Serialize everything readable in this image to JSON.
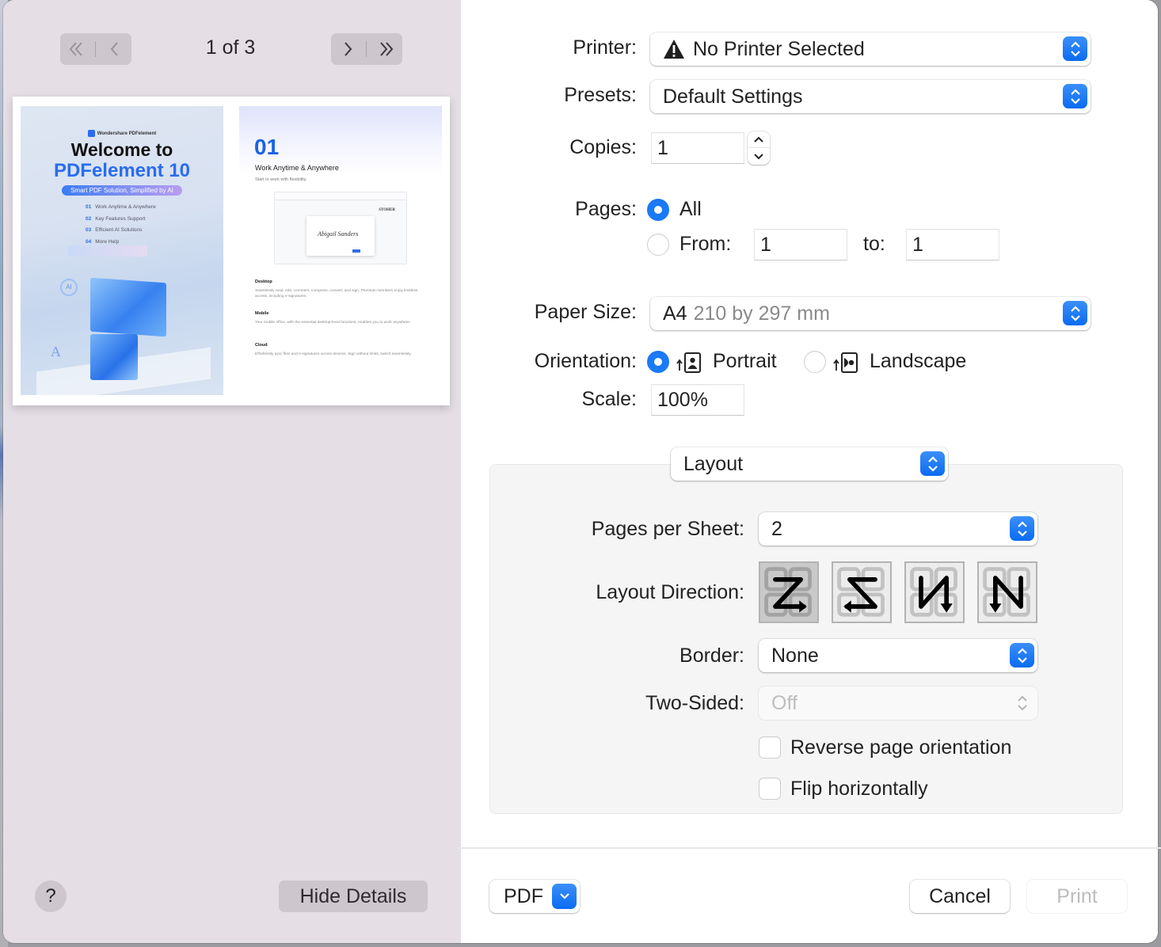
{
  "preview": {
    "page_indicator": "1 of 3",
    "nav": {
      "first_icon": "double-chevron-left-icon",
      "prev_icon": "chevron-left-icon",
      "next_icon": "chevron-right-icon",
      "last_icon": "double-chevron-right-icon"
    },
    "cover_page": {
      "brand": "Wondershare PDFelement",
      "title_line1": "Welcome to",
      "title_line2": "PDFelement 10",
      "tagline": "Smart PDF Solution, Simplified by AI",
      "toc": [
        {
          "num": "01",
          "label": "Work Anytime & Anywhere"
        },
        {
          "num": "02",
          "label": "Key Features Support"
        },
        {
          "num": "03",
          "label": "Efficient AI Solutions"
        },
        {
          "num": "04",
          "label": "More Help"
        }
      ],
      "ai_badge": "AI",
      "art_letter": "A"
    },
    "content_page": {
      "number": "01",
      "title": "Work Anytime & Anywhere",
      "subtitle": "Start to work with flexibility.",
      "mock_brand": "STOHER",
      "mock_signature": "Abigail Sanders",
      "sections": [
        {
          "heading": "Desktop",
          "body": "Seamlessly read, edit, comment, compress, convert, and sign. Premium members enjoy limitless access, including e-signatures."
        },
        {
          "heading": "Mobile",
          "body": "Your mobile office, with the essential desktop-level functions, enables you to work anywhere."
        },
        {
          "heading": "Cloud",
          "body": "Effortlessly sync files and e-signatures across devices. Sign without limits, switch seamlessly."
        }
      ]
    },
    "help_label": "?",
    "hide_details_label": "Hide Details"
  },
  "settings": {
    "printer": {
      "label": "Printer:",
      "value": "No Printer Selected",
      "icon": "warning-triangle-icon"
    },
    "presets": {
      "label": "Presets:",
      "value": "Default Settings"
    },
    "copies": {
      "label": "Copies:",
      "value": "1"
    },
    "pages": {
      "label": "Pages:",
      "all_label": "All",
      "all_selected": true,
      "from_label": "From:",
      "from_value": "1",
      "to_label": "to:",
      "to_value": "1"
    },
    "paper_size": {
      "label": "Paper Size:",
      "name": "A4",
      "dimensions": "210 by 297 mm"
    },
    "orientation": {
      "label": "Orientation:",
      "portrait_label": "Portrait",
      "landscape_label": "Landscape",
      "selected": "Portrait"
    },
    "scale": {
      "label": "Scale:",
      "value": "100%"
    }
  },
  "layout_section": {
    "menu_value": "Layout",
    "pages_per_sheet": {
      "label": "Pages per Sheet:",
      "value": "2"
    },
    "layout_direction": {
      "label": "Layout Direction:",
      "options": [
        "z-left-to-right-icon",
        "z-right-to-left-icon",
        "n-top-to-bottom-left-icon",
        "n-top-to-bottom-right-icon"
      ],
      "selected_index": 0
    },
    "border": {
      "label": "Border:",
      "value": "None"
    },
    "two_sided": {
      "label": "Two-Sided:",
      "value": "Off",
      "enabled": false
    },
    "reverse_page_orientation": {
      "label": "Reverse page orientation",
      "checked": false
    },
    "flip_horizontally": {
      "label": "Flip horizontally",
      "checked": false
    }
  },
  "footer": {
    "pdf_label": "PDF",
    "cancel_label": "Cancel",
    "print_label": "Print",
    "print_enabled": false
  },
  "colors": {
    "accent": "#0a6bf2",
    "sidebar_bg": "#e5dfe5",
    "button_bg": "#cdc7cd",
    "brand_blue": "#1b63e8"
  }
}
